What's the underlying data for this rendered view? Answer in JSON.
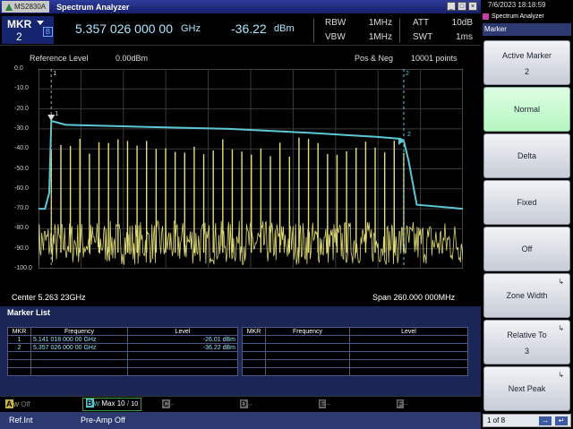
{
  "window": {
    "model": "MS2830A",
    "title": "Spectrum Analyzer",
    "buttons": [
      "_",
      "□",
      "×"
    ]
  },
  "header": {
    "marker_label": "MKR",
    "marker_number": "2",
    "marker_badge": "B",
    "marker_freq": "5.357 026 000 00",
    "marker_freq_unit": "GHz",
    "marker_level": "-36.22",
    "marker_level_unit": "dBm",
    "params": [
      {
        "label": "RBW",
        "value": "1MHz"
      },
      {
        "label": "VBW",
        "value": "1MHz"
      },
      {
        "label": "ATT",
        "value": "10dB"
      },
      {
        "label": "SWT",
        "value": "1ms"
      }
    ]
  },
  "graph": {
    "reference_label": "Reference Level",
    "reference_value": "0.00dBm",
    "detector": "Pos & Neg",
    "points": "10001 points",
    "center": "Center 5.263 23GHz",
    "span": "Span 260.000 000MHz",
    "y_ticks": [
      "0.0",
      "-10.0",
      "-20.0",
      "-30.0",
      "-40.0",
      "-50.0",
      "-60.0",
      "-70.0",
      "-80.0",
      "-90.0",
      "-100.0"
    ],
    "marker_tags": [
      "1",
      "2"
    ]
  },
  "chart_data": {
    "type": "line",
    "xlabel": "",
    "ylabel": "",
    "ylim": [
      -100,
      0
    ],
    "x_center_ghz": 5.26323,
    "x_span_mhz": 260,
    "grid": true,
    "series": [
      {
        "color": "#5cc8d6",
        "kind": "max-hold",
        "x": [
          5.13323,
          5.1372,
          5.1398,
          5.1411,
          5.15,
          5.2,
          5.25,
          5.3,
          5.34,
          5.355,
          5.357,
          5.36,
          5.365,
          5.3932
        ],
        "y": [
          -70,
          -70,
          -62,
          -26,
          -28,
          -29,
          -30,
          -32,
          -34,
          -35,
          -36,
          -46,
          -68,
          -70
        ]
      },
      {
        "color": "#e6e07a",
        "kind": "noise",
        "y_range": [
          -98,
          -76
        ],
        "spikes_y": -34
      }
    ],
    "markers": [
      {
        "id": "1",
        "freq_ghz": 5.141018,
        "level_dbm": -26.01
      },
      {
        "id": "2",
        "freq_ghz": 5.357026,
        "level_dbm": -36.22
      }
    ]
  },
  "marker_list": {
    "title": "Marker List",
    "columns": [
      "MKR",
      "Frequency",
      "Level"
    ],
    "rows": [
      {
        "mkr": "1",
        "freq": "5.141 018 000 00 GHz",
        "level": "-26.01 dBm"
      },
      {
        "mkr": "2",
        "freq": "5.357 026 000 00 GHz",
        "level": "-36.22 dBm"
      }
    ]
  },
  "traces": {
    "a_label": "A",
    "a_sub": "W",
    "a_state": "Off",
    "b_label": "B",
    "b_sub": "W",
    "b_state": "Max",
    "b_count": "10",
    "b_total": "10",
    "c_label": "C",
    "c_state": "--",
    "d_label": "D",
    "d_state": "--",
    "e_label": "E",
    "e_state": "--",
    "f_label": "F",
    "f_state": "--"
  },
  "status": {
    "ref": "Ref.Int",
    "preamp": "Pre-Amp Off"
  },
  "right": {
    "clock": "7/6/2023 18:18:59",
    "app": "Spectrum Analyzer",
    "function": "Marker",
    "softkeys": [
      {
        "title": "Active Marker",
        "sub": "2",
        "corner": ""
      },
      {
        "title": "Normal",
        "sub": "",
        "corner": ""
      },
      {
        "title": "Delta",
        "sub": "",
        "corner": ""
      },
      {
        "title": "Fixed",
        "sub": "",
        "corner": ""
      },
      {
        "title": "Off",
        "sub": "",
        "corner": ""
      },
      {
        "title": "Zone Width",
        "sub": "",
        "corner": "↳"
      },
      {
        "title": "Relative To",
        "sub": "3",
        "corner": "↳"
      },
      {
        "title": "Next Peak",
        "sub": "",
        "corner": "↳"
      }
    ],
    "pager": "1 of 8"
  },
  "colors": {
    "title_bar": "#16206a",
    "trace_max": "#5cc8d6",
    "trace_noise": "#e6e07a",
    "softkey_active": "#b5f5c0"
  }
}
